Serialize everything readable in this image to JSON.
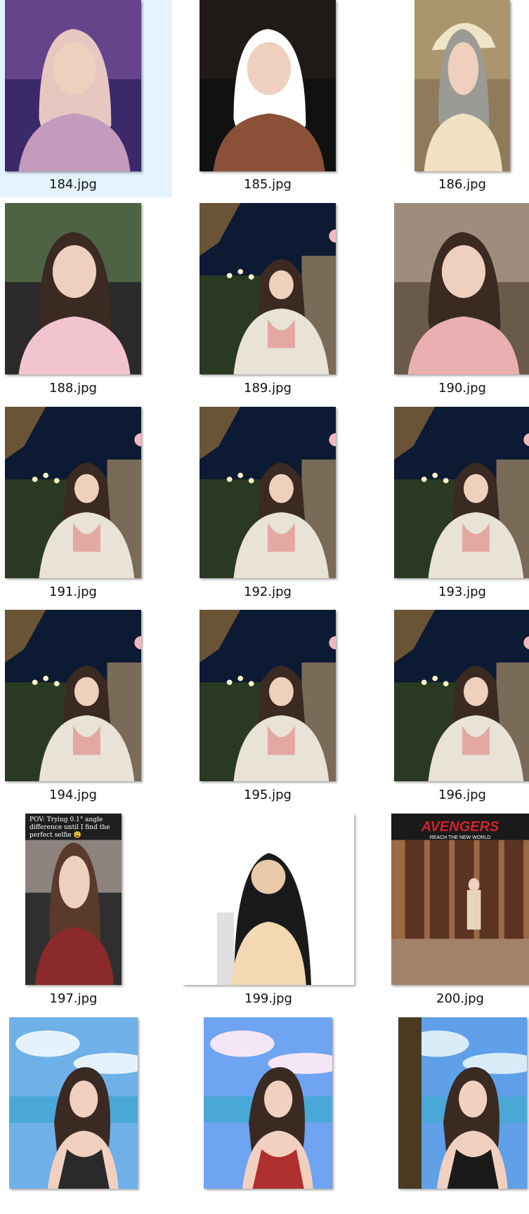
{
  "files": [
    {
      "name": "184.jpg",
      "selected": true,
      "palette": [
        "#3a2a6a",
        "#8a5aa8",
        "#c49bbd",
        "#e7c8c0"
      ],
      "subject": "portrait-purple-lights",
      "orientation": "portrait"
    },
    {
      "name": "185.jpg",
      "selected": false,
      "palette": [
        "#111111",
        "#2b211d",
        "#8a5138",
        "#ffffff"
      ],
      "subject": "portrait-white-tee",
      "orientation": "portrait"
    },
    {
      "name": "186.jpg",
      "selected": false,
      "palette": [
        "#8f7a5a",
        "#c3ab82",
        "#efe1c2",
        "#9c9a95"
      ],
      "subject": "portrait-cap",
      "orientation": "portrait"
    },
    {
      "name": "188.jpg",
      "selected": false,
      "palette": [
        "#2a2a2a",
        "#6c8f5a",
        "#f2c4cf",
        "#3a2a22"
      ],
      "subject": "portrait-car-pink",
      "orientation": "portrait"
    },
    {
      "name": "189.jpg",
      "selected": false,
      "palette": [
        "#0d1a33",
        "#5a4a2a",
        "#e8e2d7",
        "#3a2a22"
      ],
      "subject": "night-portrait",
      "orientation": "portrait"
    },
    {
      "name": "190.jpg",
      "selected": false,
      "palette": [
        "#6a5a4a",
        "#c8b8a8",
        "#e8b0b0",
        "#3a2a22"
      ],
      "subject": "portrait-cardigan",
      "orientation": "portrait"
    },
    {
      "name": "191.jpg",
      "selected": false,
      "palette": [
        "#0d1a33",
        "#5a4a2a",
        "#e8e2d7",
        "#3a2a22"
      ],
      "subject": "night-portrait",
      "orientation": "portrait"
    },
    {
      "name": "192.jpg",
      "selected": false,
      "palette": [
        "#0d1a33",
        "#5a4a2a",
        "#e8e2d7",
        "#3a2a22"
      ],
      "subject": "night-portrait",
      "orientation": "portrait"
    },
    {
      "name": "193.jpg",
      "selected": false,
      "palette": [
        "#0d1a33",
        "#5a4a2a",
        "#e8e2d7",
        "#3a2a22"
      ],
      "subject": "night-portrait",
      "orientation": "portrait"
    },
    {
      "name": "194.jpg",
      "selected": false,
      "palette": [
        "#0d1a33",
        "#5a4a2a",
        "#e8e2d7",
        "#3a2a22"
      ],
      "subject": "night-portrait",
      "orientation": "portrait"
    },
    {
      "name": "195.jpg",
      "selected": false,
      "palette": [
        "#0d1a33",
        "#5a4a2a",
        "#e8e2d7",
        "#3a2a22"
      ],
      "subject": "night-portrait",
      "orientation": "portrait"
    },
    {
      "name": "196.jpg",
      "selected": false,
      "palette": [
        "#0d1a33",
        "#5a4a2a",
        "#e8e2d7",
        "#3a2a22"
      ],
      "subject": "night-portrait",
      "orientation": "portrait"
    },
    {
      "name": "197.jpg",
      "selected": false,
      "palette": [
        "#2f2f2f",
        "#d9c6c0",
        "#8a2a2a",
        "#5a3a2a"
      ],
      "subject": "portrait-caption",
      "orientation": "portrait",
      "caption": "POV: Trying 0.1° angle difference until I find the perfect selfie 😩"
    },
    {
      "name": "199.jpg",
      "selected": false,
      "palette": [
        "#ffffff",
        "#f2d9b3",
        "#e8c9a8",
        "#1a1a1a"
      ],
      "subject": "portrait-white-bg",
      "orientation": "portrait"
    },
    {
      "name": "200.jpg",
      "selected": false,
      "palette": [
        "#5a3420",
        "#9a6a45",
        "#e6d6c0",
        "#c9303a"
      ],
      "subject": "avengers-event",
      "orientation": "portrait",
      "sign_title": "AVENGERS",
      "sign_sub": "REACH THE NEW WORLD"
    },
    {
      "name": "",
      "selected": false,
      "palette": [
        "#6fb0e8",
        "#e6f2fb",
        "#2a2a2a",
        "#f2d0c0"
      ],
      "subject": "beach-selfie",
      "orientation": "portrait"
    },
    {
      "name": "",
      "selected": false,
      "palette": [
        "#6fa4f2",
        "#f4e6f6",
        "#b03030",
        "#f2d0c0"
      ],
      "subject": "beach-selfie",
      "orientation": "portrait"
    },
    {
      "name": "",
      "selected": false,
      "palette": [
        "#5fa0e8",
        "#d8ecf8",
        "#1a1a1a",
        "#f2d0c0"
      ],
      "subject": "beach-selfie-rock",
      "orientation": "portrait"
    }
  ]
}
